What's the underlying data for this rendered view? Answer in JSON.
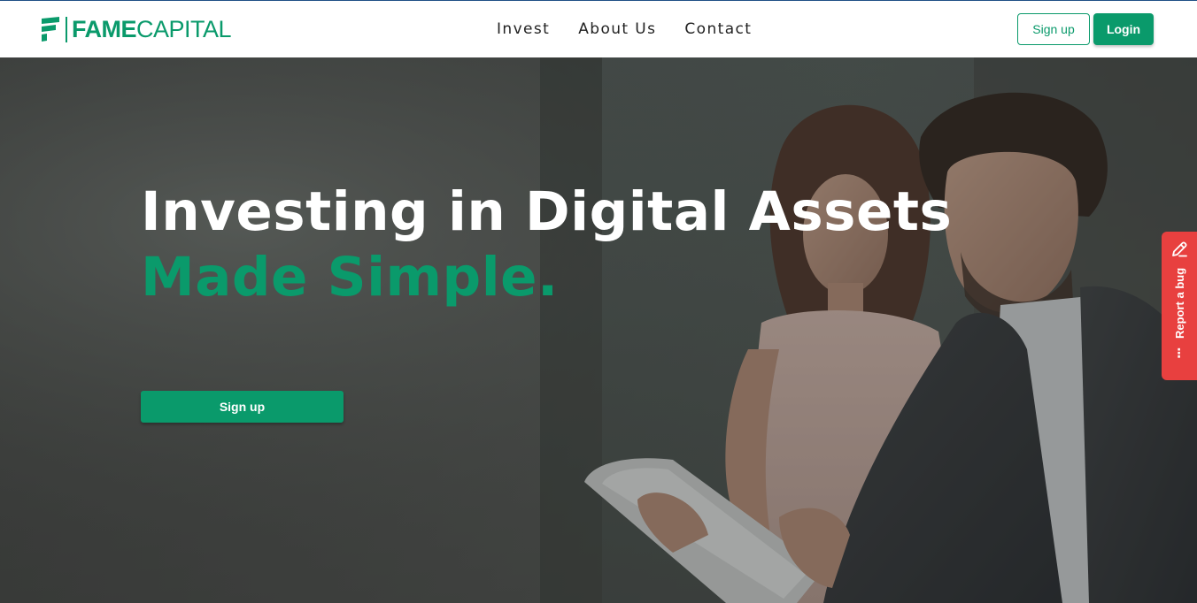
{
  "brand": {
    "name_bold": "FAME",
    "name_light": "CAPITAL",
    "accent_color": "#0a9a6b"
  },
  "nav": {
    "items": [
      {
        "label": "Invest"
      },
      {
        "label": "About Us"
      },
      {
        "label": "Contact"
      }
    ]
  },
  "header_actions": {
    "signup_label": "Sign up",
    "login_label": "Login"
  },
  "hero": {
    "title": "Investing in Digital Assets",
    "subtitle": "Made Simple.",
    "cta_label": "Sign up",
    "background_image": "two-business-people-looking-at-tablet"
  },
  "bug_widget": {
    "label": "Report a bug",
    "icon": "pencil-icon",
    "more_icon": "more-dots-icon",
    "color": "#e8403f"
  }
}
